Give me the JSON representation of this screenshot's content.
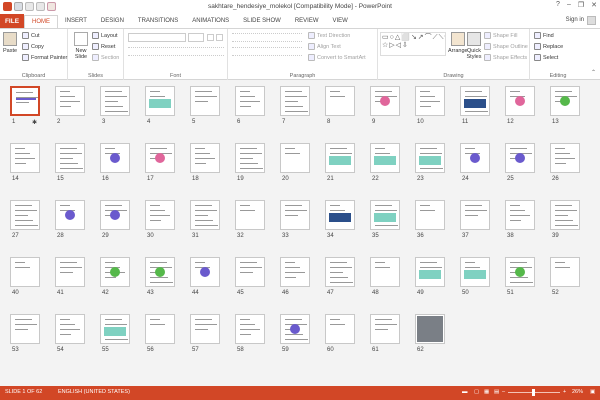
{
  "window": {
    "title": "sakhtare_hendesiye_molekol [Compatibility Mode] - PowerPoint",
    "minimize": "–",
    "restore": "❐",
    "close": "✕",
    "help": "?"
  },
  "tabs": {
    "file": "FILE",
    "items": [
      "HOME",
      "INSERT",
      "DESIGN",
      "TRANSITIONS",
      "ANIMATIONS",
      "SLIDE SHOW",
      "REVIEW",
      "VIEW"
    ],
    "active": "HOME",
    "signin": "Sign in"
  },
  "ribbon": {
    "clipboard": {
      "label": "Clipboard",
      "paste": "Paste",
      "cut": "Cut",
      "copy": "Copy",
      "format_painter": "Format Painter"
    },
    "slides": {
      "label": "Slides",
      "new_slide": "New Slide",
      "layout": "Layout",
      "reset": "Reset",
      "section": "Section"
    },
    "font": {
      "label": "Font"
    },
    "paragraph": {
      "label": "Paragraph",
      "text_direction": "Text Direction",
      "align_text": "Align Text",
      "convert": "Convert to SmartArt"
    },
    "drawing": {
      "label": "Drawing",
      "arrange": "Arrange",
      "quick_styles": "Quick Styles",
      "shape_fill": "Shape Fill",
      "shape_outline": "Shape Outline",
      "shape_effects": "Shape Effects"
    },
    "editing": {
      "label": "Editing",
      "find": "Find",
      "replace": "Replace",
      "select": "Select"
    }
  },
  "slides": {
    "count": 62,
    "selected": 1,
    "numbers": [
      "1",
      "2",
      "3",
      "4",
      "5",
      "6",
      "7",
      "8",
      "9",
      "10",
      "11",
      "12",
      "13",
      "14",
      "15",
      "16",
      "17",
      "18",
      "19",
      "20",
      "21",
      "22",
      "23",
      "24",
      "25",
      "26",
      "27",
      "28",
      "29",
      "30",
      "31",
      "32",
      "33",
      "34",
      "35",
      "36",
      "37",
      "38",
      "39",
      "40",
      "41",
      "42",
      "43",
      "44",
      "45",
      "46",
      "47",
      "48",
      "49",
      "50",
      "51",
      "52",
      "53",
      "54",
      "55",
      "56",
      "57",
      "58",
      "59",
      "60",
      "61",
      "62"
    ],
    "accent_colors": {
      "selection": "#d24726",
      "teal": "#7fd1c1",
      "purple": "#6a5acd",
      "dark_blue": "#2b4f8a",
      "green": "#55b84a",
      "pink": "#e0669b"
    }
  },
  "status": {
    "slide_info": "SLIDE 1 OF 62",
    "language": "ENGLISH (UNITED STATES)",
    "zoom": "26%",
    "zoom_value": 26
  }
}
